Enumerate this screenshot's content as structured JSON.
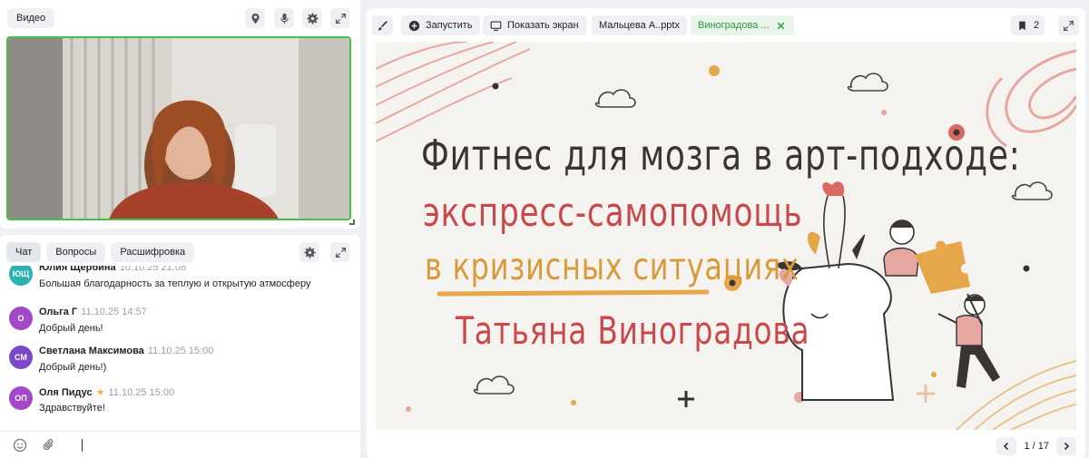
{
  "video": {
    "tab_label": "Видео"
  },
  "chat": {
    "tabs": [
      "Чат",
      "Вопросы",
      "Расшифровка"
    ],
    "messages": [
      {
        "initials": "ЮЩ",
        "name": "Юлия Щербина",
        "time": "10.10.25 21:08",
        "text": "Большая благодарность за теплую и открытую атмосферу",
        "color": "#2bb3b3"
      },
      {
        "initials": "О",
        "name": "Ольга Г",
        "time": "11.10.25 14:57",
        "text": "Добрый день!",
        "color": "#a248c9"
      },
      {
        "initials": "СМ",
        "name": "Светлана Максимова",
        "time": "11.10.25 15:00",
        "text": "Добрый день!)",
        "color": "#7b49c7"
      },
      {
        "initials": "ОП",
        "name": "Оля Пидус",
        "time": "11.10.25 15:00",
        "text": "Здравствуйте!",
        "color": "#a248c9",
        "star": "★"
      }
    ]
  },
  "toolbar": {
    "launch_label": "Запустить",
    "share_label": "Показать экран",
    "file1": "Мальцева А..pptx",
    "file2": "Виноградова ...",
    "bookmark_count": "2"
  },
  "slide": {
    "line1": "Фитнес для мозга в арт-подходе:",
    "line2": "экспресс-самопомощь",
    "line3": "в кризисных ситуациях",
    "line4": "Татьяна Виноградова"
  },
  "pager": {
    "text": "1 / 17"
  },
  "colors": {
    "accent_green": "#46c04d",
    "title_dark": "#3a3533",
    "title_red": "#c9484a",
    "title_gold": "#d99a3c"
  }
}
